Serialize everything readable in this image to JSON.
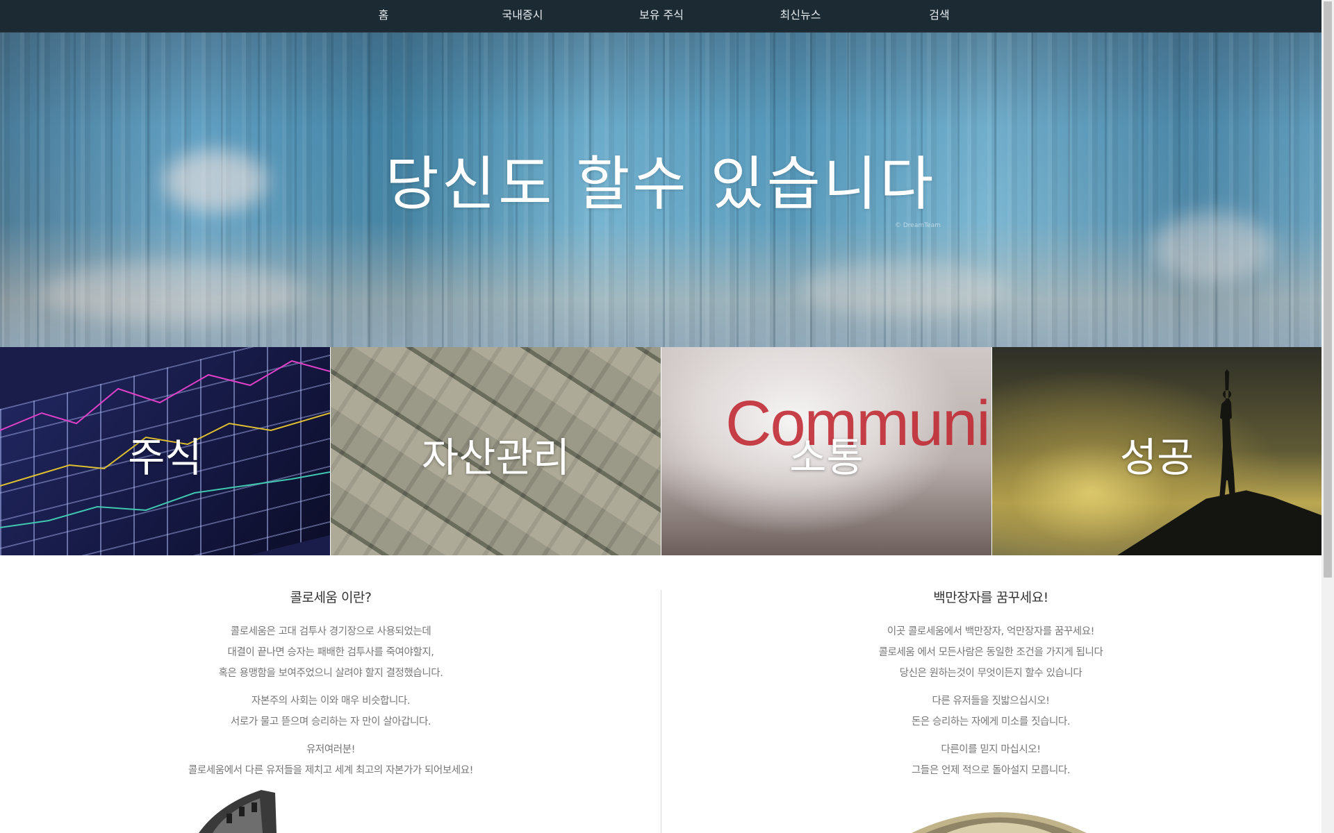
{
  "nav": {
    "items": [
      {
        "label": "홈"
      },
      {
        "label": "국내증시"
      },
      {
        "label": "보유 주식"
      },
      {
        "label": "최신뉴스"
      },
      {
        "label": "검색"
      }
    ]
  },
  "hero": {
    "title": "당신도  할수  있습니다",
    "credit": "© DreamTeam"
  },
  "tiles": [
    {
      "label": "주식"
    },
    {
      "label": "자산관리"
    },
    {
      "label": "소통",
      "image_text": "Communicat"
    },
    {
      "label": "성공"
    }
  ],
  "left": {
    "title": "콜로세움 이란?",
    "paragraphs": [
      [
        "콜로세움은 고대 검투사 경기장으로 사용되었는데",
        "대결이 끝나면 승자는 패배한 검투사를 죽여야할지,",
        "혹은 용맹함을 보여주었으니 살려야 할지 결정했습니다."
      ],
      [
        "자본주의 사회는 이와 매우 비슷합니다.",
        "서로가 물고 뜯으며 승리하는 자 만이 살아갑니다."
      ],
      [
        "유저여러분!",
        "콜로세움에서 다른 유저들을 제치고 세계 최고의 자본가가 되어보세요!"
      ]
    ]
  },
  "right": {
    "title": "백만장자를 꿈꾸세요!",
    "paragraphs": [
      [
        "이곳 콜로세움에서 백만장자, 억만장자를 꿈꾸세요!",
        "콜로세움 에서 모든사람은 동일한 조건을 가지게 됩니다",
        "당신은 원하는것이 무엇이든지 할수 있습니다"
      ],
      [
        "다른 유저들을 짓밟으십시오!",
        "돈은 승리하는 자에게 미소를 짓습니다."
      ],
      [
        "다른이를 믿지 마십시오!",
        "그들은 언제 적으로 돌아설지 모릅니다."
      ]
    ]
  },
  "colors": {
    "nav_bg": "#1c2a33",
    "text_muted": "#777777",
    "title_text": "#333333"
  }
}
